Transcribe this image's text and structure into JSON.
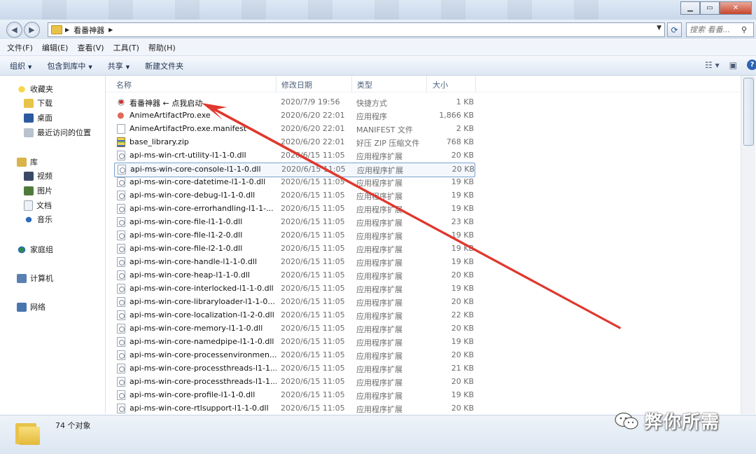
{
  "window": {
    "address_path": "看番神器",
    "search_placeholder": "搜索 看番..."
  },
  "menu": [
    "文件(F)",
    "编辑(E)",
    "查看(V)",
    "工具(T)",
    "帮助(H)"
  ],
  "commands": {
    "organize": "组织",
    "include": "包含到库中",
    "share": "共享",
    "new_folder": "新建文件夹"
  },
  "nav": {
    "favorites": "收藏夹",
    "downloads": "下载",
    "desktop": "桌面",
    "recent": "最近访问的位置",
    "libraries": "库",
    "videos": "视频",
    "pictures": "图片",
    "documents": "文档",
    "music": "音乐",
    "homegroup": "家庭组",
    "computer": "计算机",
    "network": "网络"
  },
  "columns": {
    "name": "名称",
    "date": "修改日期",
    "type": "类型",
    "size": "大小"
  },
  "files": [
    {
      "name": "看番神器 ← 点我启动",
      "date": "2020/7/9 19:56",
      "type": "快捷方式",
      "size": "1 KB",
      "icon": "lnk"
    },
    {
      "name": "AnimeArtifactPro.exe",
      "date": "2020/6/20 22:01",
      "type": "应用程序",
      "size": "1,866 KB",
      "icon": "exe"
    },
    {
      "name": "AnimeArtifactPro.exe.manifest",
      "date": "2020/6/20 22:01",
      "type": "MANIFEST 文件",
      "size": "2 KB",
      "icon": "file"
    },
    {
      "name": "base_library.zip",
      "date": "2020/6/20 22:01",
      "type": "好压 ZIP 压缩文件",
      "size": "768 KB",
      "icon": "zip"
    },
    {
      "name": "api-ms-win-crt-utility-l1-1-0.dll",
      "date": "2020/6/15 11:05",
      "type": "应用程序扩展",
      "size": "20 KB",
      "icon": "dll"
    },
    {
      "name": "api-ms-win-core-console-l1-1-0.dll",
      "date": "2020/6/15 11:05",
      "type": "应用程序扩展",
      "size": "20 KB",
      "icon": "dll"
    },
    {
      "name": "api-ms-win-core-datetime-l1-1-0.dll",
      "date": "2020/6/15 11:05",
      "type": "应用程序扩展",
      "size": "19 KB",
      "icon": "dll"
    },
    {
      "name": "api-ms-win-core-debug-l1-1-0.dll",
      "date": "2020/6/15 11:05",
      "type": "应用程序扩展",
      "size": "19 KB",
      "icon": "dll"
    },
    {
      "name": "api-ms-win-core-errorhandling-l1-1-...",
      "date": "2020/6/15 11:05",
      "type": "应用程序扩展",
      "size": "19 KB",
      "icon": "dll"
    },
    {
      "name": "api-ms-win-core-file-l1-1-0.dll",
      "date": "2020/6/15 11:05",
      "type": "应用程序扩展",
      "size": "23 KB",
      "icon": "dll"
    },
    {
      "name": "api-ms-win-core-file-l1-2-0.dll",
      "date": "2020/6/15 11:05",
      "type": "应用程序扩展",
      "size": "19 KB",
      "icon": "dll"
    },
    {
      "name": "api-ms-win-core-file-l2-1-0.dll",
      "date": "2020/6/15 11:05",
      "type": "应用程序扩展",
      "size": "19 KB",
      "icon": "dll"
    },
    {
      "name": "api-ms-win-core-handle-l1-1-0.dll",
      "date": "2020/6/15 11:05",
      "type": "应用程序扩展",
      "size": "19 KB",
      "icon": "dll"
    },
    {
      "name": "api-ms-win-core-heap-l1-1-0.dll",
      "date": "2020/6/15 11:05",
      "type": "应用程序扩展",
      "size": "20 KB",
      "icon": "dll"
    },
    {
      "name": "api-ms-win-core-interlocked-l1-1-0.dll",
      "date": "2020/6/15 11:05",
      "type": "应用程序扩展",
      "size": "19 KB",
      "icon": "dll"
    },
    {
      "name": "api-ms-win-core-libraryloader-l1-1-0...",
      "date": "2020/6/15 11:05",
      "type": "应用程序扩展",
      "size": "20 KB",
      "icon": "dll"
    },
    {
      "name": "api-ms-win-core-localization-l1-2-0.dll",
      "date": "2020/6/15 11:05",
      "type": "应用程序扩展",
      "size": "22 KB",
      "icon": "dll"
    },
    {
      "name": "api-ms-win-core-memory-l1-1-0.dll",
      "date": "2020/6/15 11:05",
      "type": "应用程序扩展",
      "size": "20 KB",
      "icon": "dll"
    },
    {
      "name": "api-ms-win-core-namedpipe-l1-1-0.dll",
      "date": "2020/6/15 11:05",
      "type": "应用程序扩展",
      "size": "19 KB",
      "icon": "dll"
    },
    {
      "name": "api-ms-win-core-processenvironmen...",
      "date": "2020/6/15 11:05",
      "type": "应用程序扩展",
      "size": "20 KB",
      "icon": "dll"
    },
    {
      "name": "api-ms-win-core-processthreads-l1-1...",
      "date": "2020/6/15 11:05",
      "type": "应用程序扩展",
      "size": "21 KB",
      "icon": "dll"
    },
    {
      "name": "api-ms-win-core-processthreads-l1-1...",
      "date": "2020/6/15 11:05",
      "type": "应用程序扩展",
      "size": "20 KB",
      "icon": "dll"
    },
    {
      "name": "api-ms-win-core-profile-l1-1-0.dll",
      "date": "2020/6/15 11:05",
      "type": "应用程序扩展",
      "size": "19 KB",
      "icon": "dll"
    },
    {
      "name": "api-ms-win-core-rtlsupport-l1-1-0.dll",
      "date": "2020/6/15 11:05",
      "type": "应用程序扩展",
      "size": "20 KB",
      "icon": "dll"
    }
  ],
  "selected_row": 5,
  "status": {
    "count": "74 个对象"
  },
  "watermark": "弊你所需",
  "annotation_arrow_color": "#e0382e"
}
